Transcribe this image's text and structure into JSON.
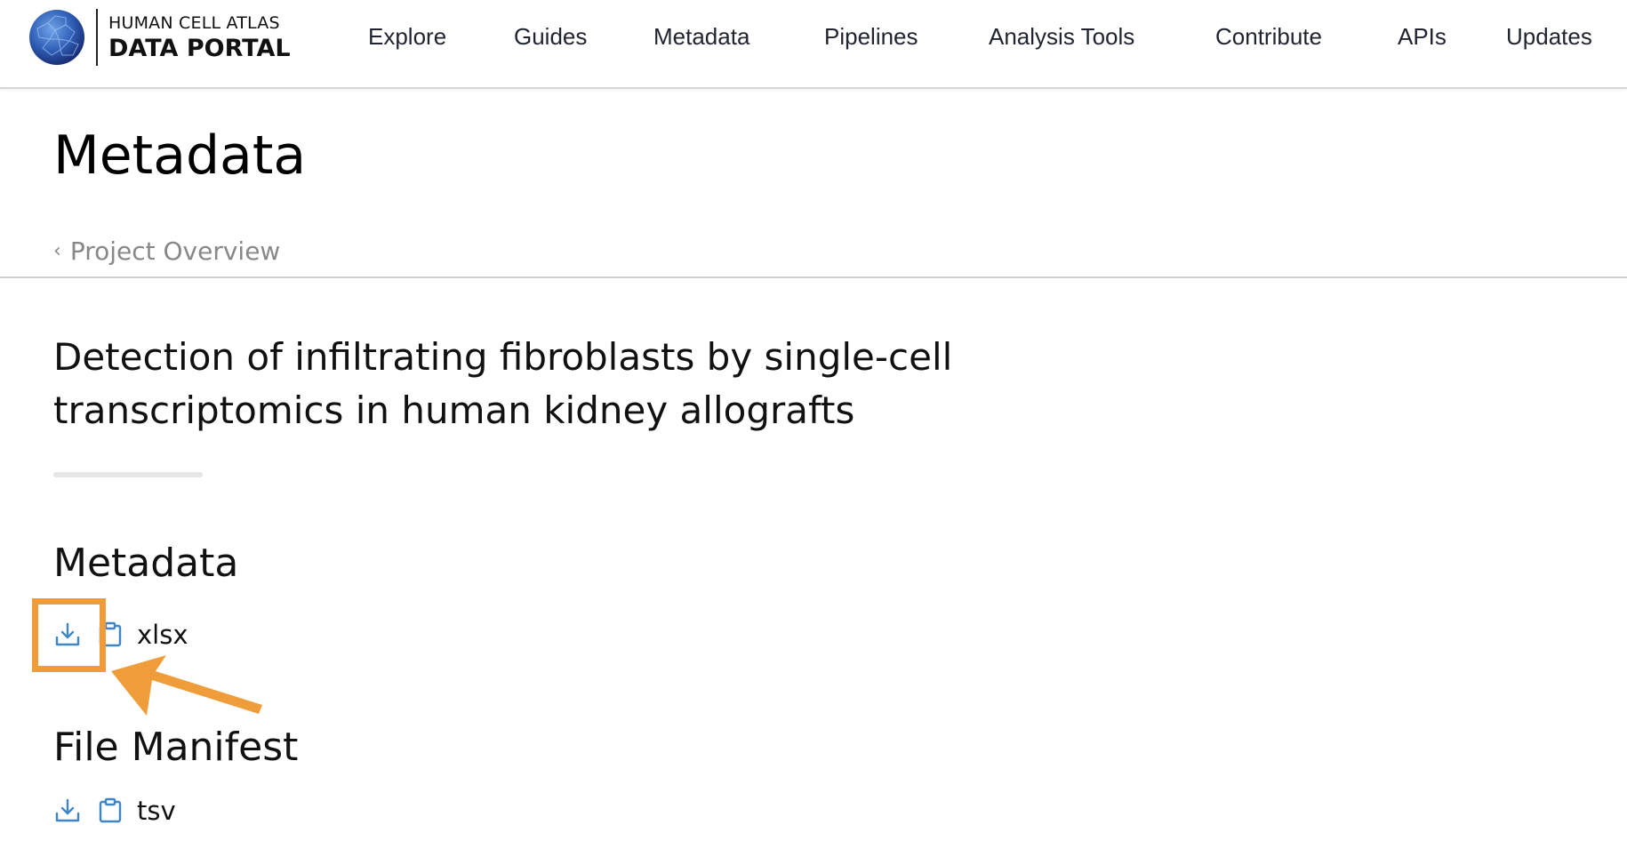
{
  "header": {
    "logo_line1": "HUMAN CELL ATLAS",
    "logo_line2": "DATA PORTAL",
    "nav": [
      "Explore",
      "Guides",
      "Metadata",
      "Pipelines",
      "Analysis Tools",
      "Contribute",
      "APIs",
      "Updates"
    ]
  },
  "page": {
    "title": "Metadata",
    "breadcrumb": "Project Overview",
    "project_title": "Detection of infiltrating fibroblasts by single-cell transcriptomics in human kidney allografts"
  },
  "sections": [
    {
      "heading": "Metadata",
      "format": "xlsx",
      "icons": [
        "download-icon",
        "clipboard-icon"
      ]
    },
    {
      "heading": "File Manifest",
      "format": "tsv",
      "icons": [
        "download-icon",
        "clipboard-icon"
      ]
    }
  ],
  "colors": {
    "icon_blue": "#3f86c7",
    "annotation_orange": "#ef9d3a"
  }
}
